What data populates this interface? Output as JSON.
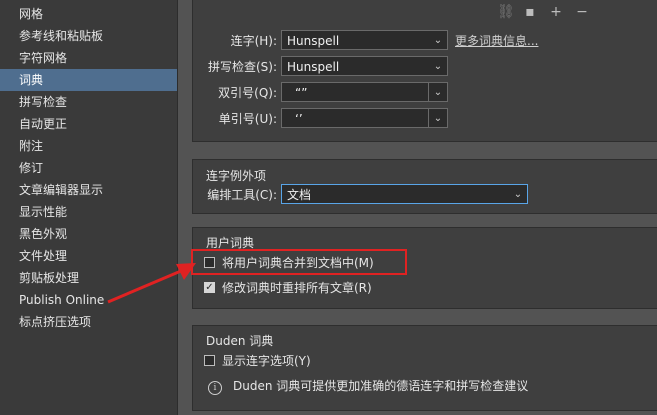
{
  "sidebar": {
    "items": [
      {
        "label": "网格"
      },
      {
        "label": "参考线和粘贴板"
      },
      {
        "label": "字符网格"
      },
      {
        "label": "词典",
        "selected": true
      },
      {
        "label": "拼写检查"
      },
      {
        "label": "自动更正"
      },
      {
        "label": "附注"
      },
      {
        "label": "修订"
      },
      {
        "label": "文章编辑器显示"
      },
      {
        "label": "显示性能"
      },
      {
        "label": "黑色外观"
      },
      {
        "label": "文件处理"
      },
      {
        "label": "剪贴板处理"
      },
      {
        "label": "Publish Online"
      },
      {
        "label": "标点挤压选项"
      }
    ]
  },
  "toolbar": {
    "icons": [
      "link-icon",
      "save-icon",
      "add-icon",
      "remove-icon"
    ]
  },
  "language_panel": {
    "hyphenation": {
      "label": "连字(H):",
      "value": "Hunspell"
    },
    "more_info_link": "更多词典信息...",
    "spelling": {
      "label": "拼写检查(S):",
      "value": "Hunspell"
    },
    "double_quotes": {
      "label": "双引号(Q):",
      "value": "“”"
    },
    "single_quotes": {
      "label": "单引号(U):",
      "value": "‘’"
    }
  },
  "hyphenation_exceptions": {
    "title": "连字例外项",
    "compose_using": {
      "label": "编排工具(C):",
      "value": "文档"
    }
  },
  "user_dictionary": {
    "title": "用户词典",
    "merge": {
      "label": "将用户词典合并到文档中(M)",
      "checked": false
    },
    "recompose": {
      "label": "修改词典时重排所有文章(R)",
      "checked": true
    }
  },
  "duden": {
    "title": "Duden 词典",
    "show_options": {
      "label": "显示连字选项(Y)",
      "checked": false
    },
    "info_text": "Duden 词典可提供更加准确的德语连字和拼写检查建议"
  },
  "colors": {
    "accent_selected": "#4f6e8f",
    "highlight_red": "#e02222"
  }
}
